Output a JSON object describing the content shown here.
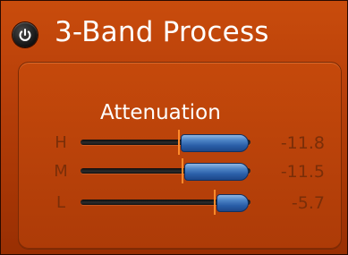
{
  "plugin": {
    "title": "3-Band Process",
    "power_icon": "power-icon"
  },
  "attenuation": {
    "label": "Attenuation",
    "bands": [
      {
        "label": "H",
        "value": "-11.8",
        "level": 0.4
      },
      {
        "label": "M",
        "value": "-11.5",
        "level": 0.38
      },
      {
        "label": "L",
        "value": "-5.7",
        "level": 0.19
      }
    ]
  },
  "colors": {
    "panel": "#b8400a",
    "handle": "#2a5ea8",
    "marker": "#ff8a2a",
    "dim_text": "#7a2e08"
  }
}
